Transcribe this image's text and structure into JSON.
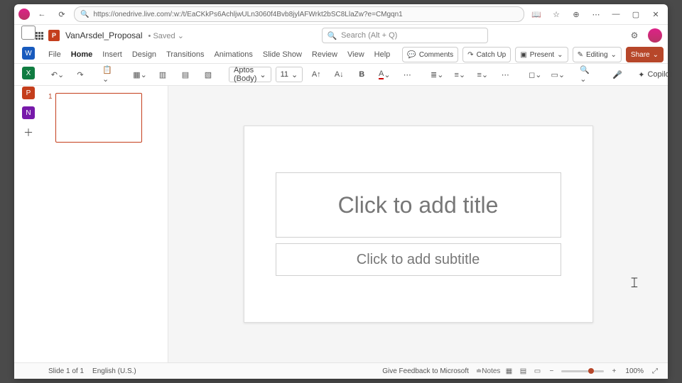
{
  "browser": {
    "url": "https://onedrive.live.com/:w:/t/EaCKkPs6AchljwULn3060f4Bvb8jylAFWrkt2bSC8LlaZw?e=CMgqn1"
  },
  "header": {
    "doc_name": "VanArsdel_Proposal",
    "saved_state": "Saved",
    "search_placeholder": "Search (Alt + Q)"
  },
  "tabs": {
    "items": [
      "File",
      "Home",
      "Insert",
      "Design",
      "Transitions",
      "Animations",
      "Slide Show",
      "Review",
      "View",
      "Help"
    ],
    "active": "Home",
    "right": {
      "comments": "Comments",
      "catchup": "Catch Up",
      "present": "Present",
      "editing": "Editing",
      "share": "Share"
    }
  },
  "ribbon": {
    "font_name": "Aptos (Body)",
    "font_size": "11",
    "copilot": "Copilot"
  },
  "slide": {
    "title_placeholder": "Click to add title",
    "subtitle_placeholder": "Click to add subtitle"
  },
  "thumb": {
    "number": "1"
  },
  "status": {
    "slide_info": "Slide 1 of 1",
    "language": "English (U.S.)",
    "feedback": "Give Feedback to Microsoft",
    "notes": "Notes",
    "zoom": "100%"
  }
}
